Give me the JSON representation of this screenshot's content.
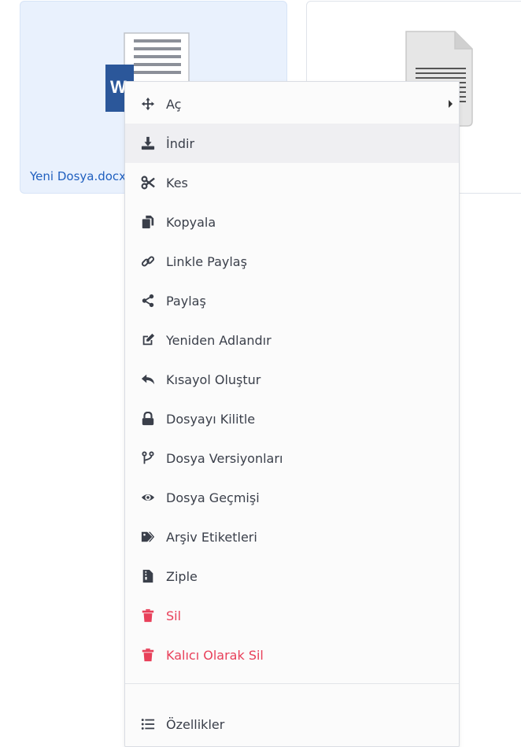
{
  "files": [
    {
      "name": "Yeni Dosya.docx",
      "icon": "word-document-icon",
      "selected": true
    },
    {
      "name": "",
      "icon": "text-document-icon",
      "selected": false
    }
  ],
  "menu": {
    "items": [
      {
        "label": "Aç",
        "icon": "move-arrows-icon",
        "submenu": true
      },
      {
        "label": "İndir",
        "icon": "download-icon"
      },
      {
        "label": "Kes",
        "icon": "scissors-icon"
      },
      {
        "label": "Kopyala",
        "icon": "copy-icon"
      },
      {
        "label": "Linkle Paylaş",
        "icon": "link-icon"
      },
      {
        "label": "Paylaş",
        "icon": "share-icon"
      },
      {
        "label": "Yeniden Adlandır",
        "icon": "edit-icon"
      },
      {
        "label": "Kısayol Oluştur",
        "icon": "reply-arrow-icon"
      },
      {
        "label": "Dosyayı Kilitle",
        "icon": "lock-icon"
      },
      {
        "label": "Dosya Versiyonları",
        "icon": "code-branch-icon"
      },
      {
        "label": "Dosya Geçmişi",
        "icon": "eye-icon"
      },
      {
        "label": "Arşiv Etiketleri",
        "icon": "tags-icon"
      },
      {
        "label": "Ziple",
        "icon": "zip-file-icon"
      },
      {
        "label": "Sil",
        "icon": "trash-icon",
        "danger": true
      },
      {
        "label": "Kalıcı Olarak Sil",
        "icon": "trash-icon",
        "danger": true
      },
      {
        "label": "Özellikler",
        "icon": "list-icon"
      }
    ]
  },
  "colors": {
    "accent": "#1f5fbf",
    "danger": "#e8405a",
    "word_blue": "#2b579a"
  }
}
